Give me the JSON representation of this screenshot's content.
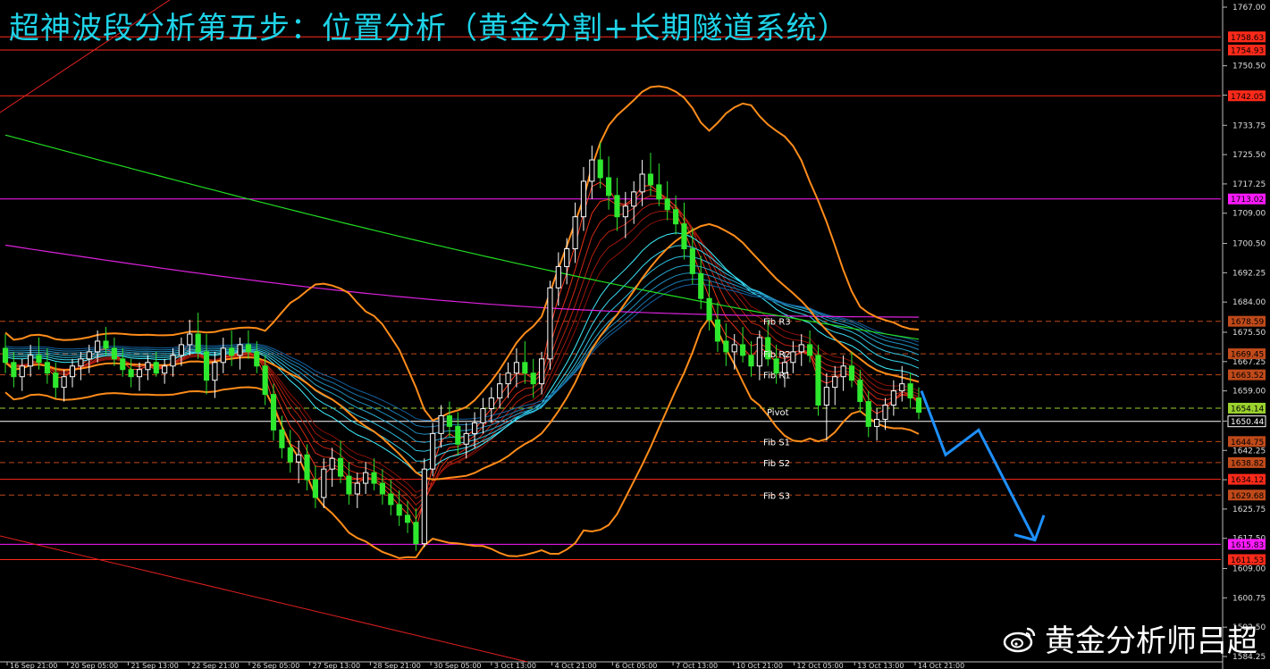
{
  "title": "超神波段分析第五步：位置分析（黄金分割+长期隧道系统）",
  "watermark": "黄金分析师吕超",
  "chart_data": {
    "type": "candlestick",
    "y_range": [
      1584.25,
      1767.0
    ],
    "grid": false,
    "y_ticks": [
      1767.0,
      1750.5,
      1742.25,
      1733.75,
      1725.5,
      1717.25,
      1709.0,
      1700.5,
      1692.25,
      1684.0,
      1675.5,
      1667.25,
      1659.0,
      1650.5,
      1642.25,
      1634.0,
      1625.75,
      1617.5,
      1609.0,
      1600.75,
      1592.5,
      1584.25
    ],
    "x_labels": [
      "16 Sep 21:00",
      "20 Sep 05:00",
      "21 Sep 13:00",
      "22 Sep 21:00",
      "26 Sep 05:00",
      "27 Sep 13:00",
      "28 Sep 21:00",
      "30 Sep 05:00",
      "3 Oct 13:00",
      "4 Oct 21:00",
      "6 Oct 05:00",
      "7 Oct 13:00",
      "10 Oct 21:00",
      "12 Oct 05:00",
      "13 Oct 13:00",
      "14 Oct 21:00"
    ],
    "candles": [
      [
        1671,
        1675,
        1664,
        1667
      ],
      [
        1667,
        1670,
        1660,
        1663
      ],
      [
        1663,
        1668,
        1659,
        1666
      ],
      [
        1666,
        1672,
        1663,
        1669
      ],
      [
        1669,
        1674,
        1665,
        1667
      ],
      [
        1667,
        1671,
        1661,
        1664
      ],
      [
        1664,
        1667,
        1657,
        1660
      ],
      [
        1660,
        1665,
        1656,
        1663
      ],
      [
        1663,
        1668,
        1660,
        1666
      ],
      [
        1666,
        1670,
        1662,
        1668
      ],
      [
        1668,
        1672,
        1664,
        1670
      ],
      [
        1670,
        1676,
        1667,
        1673
      ],
      [
        1673,
        1677,
        1669,
        1671
      ],
      [
        1671,
        1674,
        1666,
        1668
      ],
      [
        1668,
        1671,
        1663,
        1665
      ],
      [
        1665,
        1668,
        1660,
        1663
      ],
      [
        1663,
        1667,
        1659,
        1665
      ],
      [
        1665,
        1669,
        1662,
        1667
      ],
      [
        1667,
        1670,
        1663,
        1664
      ],
      [
        1664,
        1668,
        1661,
        1666
      ],
      [
        1666,
        1671,
        1663,
        1669
      ],
      [
        1669,
        1674,
        1666,
        1672
      ],
      [
        1672,
        1679,
        1669,
        1675
      ],
      [
        1675,
        1681,
        1668,
        1670
      ],
      [
        1670,
        1675,
        1658,
        1662
      ],
      [
        1662,
        1670,
        1657,
        1667
      ],
      [
        1667,
        1674,
        1664,
        1671
      ],
      [
        1671,
        1676,
        1666,
        1669
      ],
      [
        1669,
        1674,
        1665,
        1672
      ],
      [
        1672,
        1676,
        1668,
        1670
      ],
      [
        1670,
        1673,
        1664,
        1666
      ],
      [
        1666,
        1669,
        1655,
        1658
      ],
      [
        1658,
        1661,
        1645,
        1648
      ],
      [
        1648,
        1652,
        1640,
        1643
      ],
      [
        1643,
        1648,
        1636,
        1639
      ],
      [
        1639,
        1645,
        1633,
        1641
      ],
      [
        1641,
        1644,
        1631,
        1634
      ],
      [
        1634,
        1638,
        1626,
        1629
      ],
      [
        1629,
        1640,
        1626,
        1637
      ],
      [
        1637,
        1643,
        1632,
        1640
      ],
      [
        1640,
        1645,
        1633,
        1635
      ],
      [
        1635,
        1639,
        1627,
        1630
      ],
      [
        1630,
        1636,
        1626,
        1633
      ],
      [
        1633,
        1639,
        1630,
        1636
      ],
      [
        1636,
        1640,
        1631,
        1633
      ],
      [
        1633,
        1637,
        1627,
        1630
      ],
      [
        1630,
        1634,
        1624,
        1627
      ],
      [
        1627,
        1631,
        1621,
        1624
      ],
      [
        1624,
        1628,
        1619,
        1622
      ],
      [
        1622,
        1626,
        1614,
        1616
      ],
      [
        1616,
        1640,
        1615,
        1637
      ],
      [
        1637,
        1650,
        1635,
        1647
      ],
      [
        1647,
        1655,
        1643,
        1652
      ],
      [
        1652,
        1656,
        1646,
        1649
      ],
      [
        1649,
        1653,
        1641,
        1644
      ],
      [
        1644,
        1650,
        1640,
        1647
      ],
      [
        1647,
        1653,
        1643,
        1650
      ],
      [
        1650,
        1657,
        1647,
        1654
      ],
      [
        1654,
        1660,
        1650,
        1657
      ],
      [
        1657,
        1664,
        1654,
        1661
      ],
      [
        1661,
        1667,
        1657,
        1664
      ],
      [
        1664,
        1671,
        1660,
        1667
      ],
      [
        1667,
        1673,
        1661,
        1664
      ],
      [
        1664,
        1668,
        1657,
        1661
      ],
      [
        1661,
        1670,
        1658,
        1668
      ],
      [
        1668,
        1690,
        1665,
        1688
      ],
      [
        1688,
        1698,
        1683,
        1694
      ],
      [
        1694,
        1702,
        1689,
        1699
      ],
      [
        1699,
        1712,
        1695,
        1708
      ],
      [
        1708,
        1722,
        1704,
        1718
      ],
      [
        1718,
        1728,
        1713,
        1724
      ],
      [
        1724,
        1729,
        1716,
        1719
      ],
      [
        1719,
        1725,
        1710,
        1714
      ],
      [
        1714,
        1719,
        1704,
        1708
      ],
      [
        1708,
        1715,
        1702,
        1711
      ],
      [
        1711,
        1718,
        1706,
        1715
      ],
      [
        1715,
        1724,
        1711,
        1720
      ],
      [
        1720,
        1726,
        1714,
        1717
      ],
      [
        1717,
        1723,
        1711,
        1713
      ],
      [
        1713,
        1718,
        1707,
        1710
      ],
      [
        1710,
        1714,
        1703,
        1706
      ],
      [
        1706,
        1712,
        1696,
        1699
      ],
      [
        1699,
        1705,
        1689,
        1692
      ],
      [
        1692,
        1697,
        1682,
        1685
      ],
      [
        1685,
        1690,
        1676,
        1679
      ],
      [
        1679,
        1684,
        1670,
        1673
      ],
      [
        1673,
        1678,
        1666,
        1670
      ],
      [
        1670,
        1675,
        1665,
        1672
      ],
      [
        1672,
        1677,
        1667,
        1669
      ],
      [
        1669,
        1673,
        1663,
        1666
      ],
      [
        1666,
        1676,
        1662,
        1674
      ],
      [
        1674,
        1679,
        1666,
        1668
      ],
      [
        1668,
        1672,
        1661,
        1664
      ],
      [
        1664,
        1670,
        1660,
        1667
      ],
      [
        1667,
        1673,
        1664,
        1670
      ],
      [
        1670,
        1675,
        1666,
        1672
      ],
      [
        1672,
        1676,
        1667,
        1669
      ],
      [
        1669,
        1672,
        1652,
        1655
      ],
      [
        1655,
        1664,
        1645,
        1660
      ],
      [
        1660,
        1666,
        1655,
        1663
      ],
      [
        1663,
        1669,
        1659,
        1666
      ],
      [
        1666,
        1670,
        1660,
        1662
      ],
      [
        1662,
        1665,
        1653,
        1656
      ],
      [
        1656,
        1659,
        1646,
        1649
      ],
      [
        1649,
        1654,
        1645,
        1651
      ],
      [
        1651,
        1657,
        1648,
        1655
      ],
      [
        1655,
        1662,
        1652,
        1659
      ],
      [
        1659,
        1666,
        1656,
        1661
      ],
      [
        1661,
        1664,
        1654,
        1657
      ],
      [
        1657,
        1660,
        1651,
        1653
      ]
    ],
    "price_levels": [
      {
        "value": 1758.63,
        "color": "#ff2a1a",
        "label": "1758.63"
      },
      {
        "value": 1754.93,
        "color": "#ff2a1a",
        "label": "1754.93"
      },
      {
        "value": 1742.05,
        "color": "#ff2a1a",
        "label": "1742.05"
      },
      {
        "value": 1713.02,
        "color": "#ff1aff",
        "label": "1713.02"
      },
      {
        "value": 1678.59,
        "color": "#c04a1a",
        "label": "1678.59"
      },
      {
        "value": 1669.45,
        "color": "#c04a1a",
        "label": "1669.45"
      },
      {
        "value": 1663.52,
        "color": "#c04a1a",
        "label": "1663.52"
      },
      {
        "value": 1654.14,
        "color": "#9bd22e",
        "label": "1654.14"
      },
      {
        "value": 1650.44,
        "color": "#ffffff",
        "label": "1650.44"
      },
      {
        "value": 1644.75,
        "color": "#c04a1a",
        "label": "1644.75"
      },
      {
        "value": 1638.82,
        "color": "#c04a1a",
        "label": "1638.82"
      },
      {
        "value": 1634.12,
        "color": "#ff2a1a",
        "label": "1634.12"
      },
      {
        "value": 1629.68,
        "color": "#c04a1a",
        "label": "1629.68"
      },
      {
        "value": 1615.83,
        "color": "#ff1aff",
        "label": "1615.83"
      },
      {
        "value": 1611.53,
        "color": "#ff2a1a",
        "label": "1611.53"
      }
    ],
    "fib_levels": [
      {
        "name": "Fib R3",
        "value": 1678.59
      },
      {
        "name": "Fib R2",
        "value": 1669.45
      },
      {
        "name": "Fib R1",
        "value": 1663.52
      },
      {
        "name": "Pivot",
        "value": 1654.14
      },
      {
        "name": "Fib S1",
        "value": 1644.75
      },
      {
        "name": "Fib S2",
        "value": 1638.82
      },
      {
        "name": "Fib S3",
        "value": 1629.68
      }
    ],
    "forecast_path": [
      [
        1654,
        1659
      ],
      [
        1657,
        1641
      ],
      [
        1659,
        1648
      ],
      [
        1660,
        1617
      ],
      [
        1661,
        1624
      ]
    ],
    "colors": {
      "bull": "#ffffff",
      "bear": "#2ee82e",
      "bollinger": "#ff8c1a",
      "ma_green": "#22dd22",
      "ma_magenta": "#dd22dd",
      "forecast": "#1e90ff",
      "title": "#1fd3e8"
    }
  }
}
